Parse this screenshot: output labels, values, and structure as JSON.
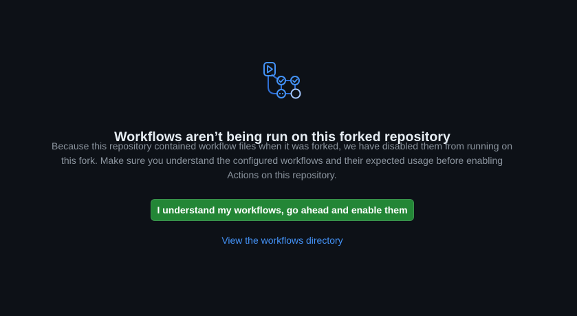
{
  "icon": "workflow-actions-icon",
  "colors": {
    "background": "#0d1117",
    "accent": "#4493f8",
    "button": "#238636",
    "muted_text": "#8b949e"
  },
  "blankslate": {
    "title": "Workflows aren’t being run on this forked repository",
    "description_lines": [
      "Because this repository contained workflow files when it was forked, we have disabled them from running on",
      "this fork. Make sure you understand the configured workflows and their expected usage before enabling",
      "Actions on this repository."
    ],
    "enable_button_label": "I understand my workflows, go ahead and enable them",
    "view_link_label": "View the workflows directory"
  }
}
